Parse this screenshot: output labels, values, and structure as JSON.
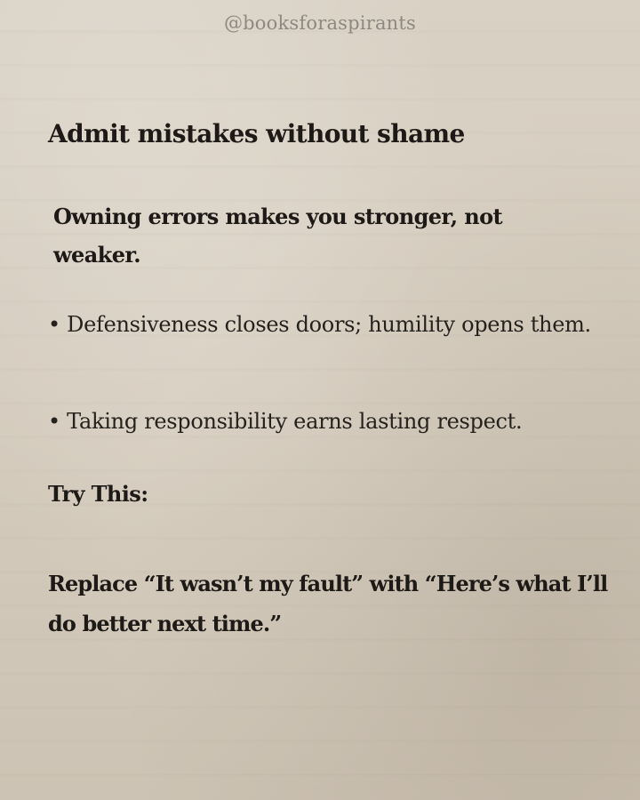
{
  "header": {
    "handle": "@booksforaspirants"
  },
  "content": {
    "heading": "Admit mistakes without shame",
    "subheading": "Owning errors makes you stronger, not weaker.",
    "bullets": [
      "• Defensiveness closes doors; humility opens them.",
      "• Taking responsibility earns lasting respect."
    ],
    "try_label": "Try This:",
    "try_text": "Replace “It wasn’t my fault” with “Here’s what I’ll do better next time.”"
  }
}
